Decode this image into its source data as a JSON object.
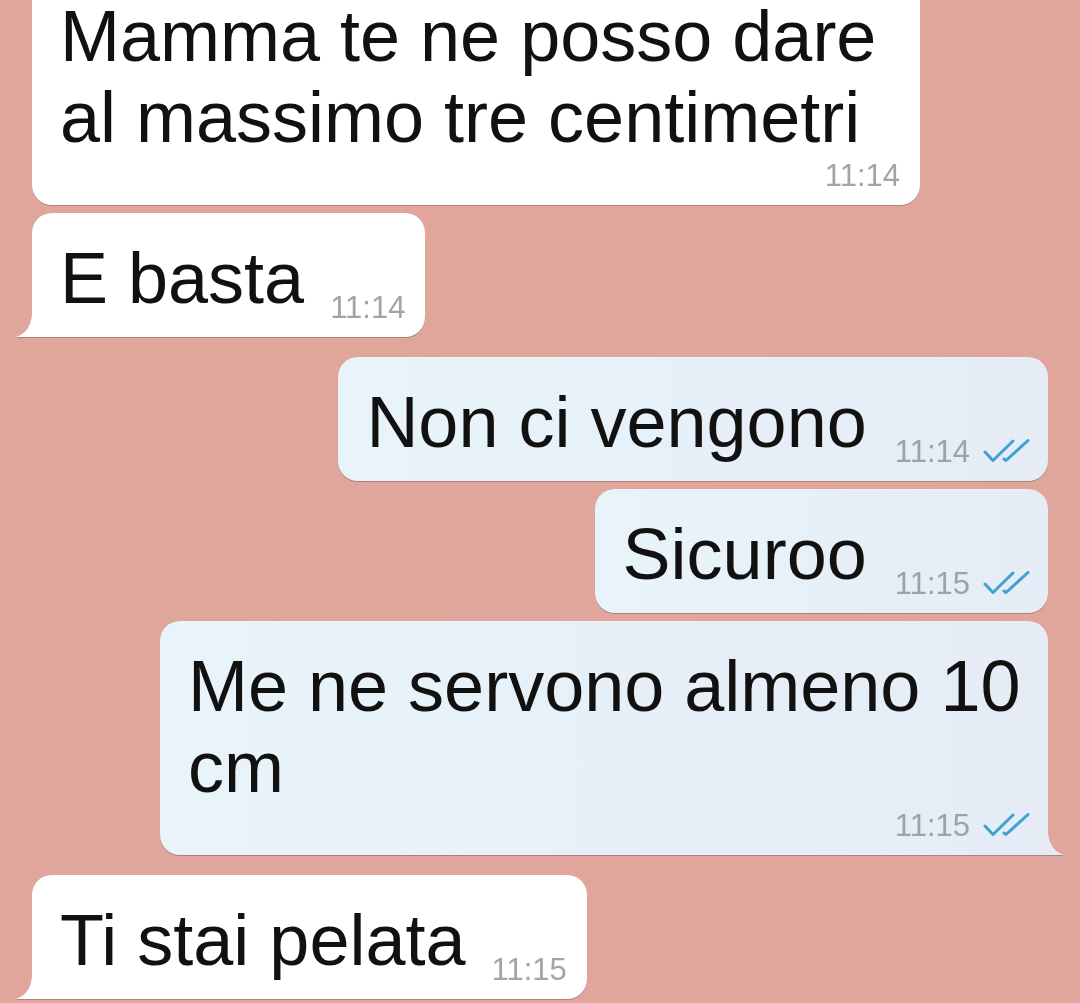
{
  "messages": [
    {
      "kind": "incoming",
      "text": "Mamma te ne posso dare al massimo tre centimetri",
      "time": "11:14",
      "tail": false
    },
    {
      "kind": "incoming",
      "text": "E basta",
      "time": "11:14",
      "tail": true
    },
    {
      "kind": "outgoing",
      "text": "Non ci vengono",
      "time": "11:14",
      "tail": false,
      "read": true
    },
    {
      "kind": "outgoing",
      "text": "Sicuroo",
      "time": "11:15",
      "tail": false,
      "read": true
    },
    {
      "kind": "outgoing",
      "text": "Me ne servono almeno 10 cm",
      "time": "11:15",
      "tail": true,
      "read": true
    },
    {
      "kind": "incoming",
      "text": "Ti stai pelata",
      "time": "11:15",
      "tail": true
    }
  ]
}
